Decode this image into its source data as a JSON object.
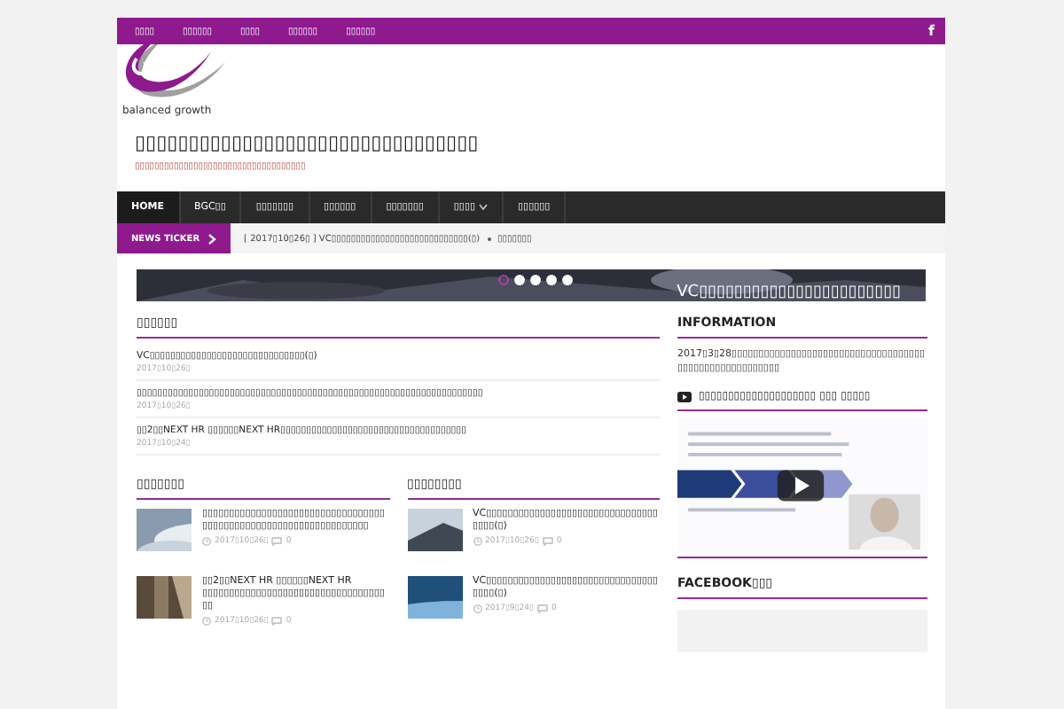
{
  "top_menu": [
    {
      "label": "▯▯▯▯"
    },
    {
      "label": "▯▯▯▯▯▯"
    },
    {
      "label": "▯▯▯▯"
    },
    {
      "label": "▯▯▯▯▯▯"
    },
    {
      "label": "▯▯▯▯▯▯"
    }
  ],
  "social": {
    "label": "f"
  },
  "logo": {
    "text": "balanced growth"
  },
  "site": {
    "title": "▯▯▯▯▯▯▯▯▯▯▯▯▯▯▯▯▯▯▯▯▯▯▯▯▯▯▯▯▯▯▯▯",
    "tagline": "▯▯▯▯▯▯▯▯▯▯▯▯▯▯▯▯▯▯▯▯▯▯▯▯▯▯▯▯▯▯▯▯▯▯▯"
  },
  "main_nav": [
    {
      "label": "HOME",
      "selected": true,
      "dropdown": false
    },
    {
      "label": "BGC▯▯",
      "selected": false,
      "dropdown": false
    },
    {
      "label": "▯▯▯▯▯▯▯",
      "selected": false,
      "dropdown": false
    },
    {
      "label": "▯▯▯▯▯▯",
      "selected": false,
      "dropdown": false
    },
    {
      "label": "▯▯▯▯▯▯▯",
      "selected": false,
      "dropdown": false
    },
    {
      "label": "▯▯▯▯",
      "selected": false,
      "dropdown": true
    },
    {
      "label": "▯▯▯▯▯▯",
      "selected": false,
      "dropdown": false
    }
  ],
  "ticker": {
    "label": "NEWS TICKER",
    "items": [
      "[ 2017▯10▯26▯ ]  VC▯▯▯▯▯▯▯▯▯▯▯▯▯▯▯▯▯▯▯▯▯▯▯▯▯▯▯▯(▯)",
      "▯▯▯▯▯▯▯"
    ]
  },
  "slider": {
    "dots": [
      {
        "selected": true
      },
      {
        "selected": false
      },
      {
        "selected": false
      },
      {
        "selected": false
      },
      {
        "selected": false
      }
    ],
    "caption": "VC▯▯▯▯▯▯▯▯▯▯▯▯▯▯▯▯▯▯▯▯▯▯▯"
  },
  "latest": {
    "heading": "▯▯▯▯▯▯",
    "posts": [
      {
        "title": "VC▯▯▯▯▯▯▯▯▯▯▯▯▯▯▯▯▯▯▯▯▯▯▯▯▯▯▯▯▯▯(▯)",
        "date": "2017▯10▯26▯"
      },
      {
        "title": "▯▯▯▯▯▯▯▯▯▯▯▯▯▯▯▯▯▯▯▯▯▯▯▯▯▯▯▯▯▯▯▯▯▯▯▯▯▯▯▯▯▯▯▯▯▯▯▯▯▯▯▯▯▯▯▯▯▯▯▯▯▯▯▯▯▯▯",
        "date": "2017▯10▯26▯"
      },
      {
        "title": "▯▯2▯▯NEXT HR ▯▯▯▯▯▯NEXT HR▯▯▯▯▯▯▯▯▯▯▯▯▯▯▯▯▯▯▯▯▯▯▯▯▯▯▯▯▯▯▯▯▯▯▯▯",
        "date": "2017▯10▯24▯"
      }
    ]
  },
  "columns": [
    {
      "heading": "▯▯▯▯▯▯▯",
      "posts": [
        {
          "title": "▯▯▯▯▯▯▯▯▯▯▯▯▯▯▯▯▯▯▯▯▯▯▯▯▯▯▯▯▯▯▯▯▯▯▯▯▯▯▯▯▯▯▯▯▯▯▯▯▯▯▯▯▯▯▯▯▯▯▯▯▯▯▯▯▯",
          "date": "2017▯10▯26▯",
          "comments": "0"
        },
        {
          "title": "▯▯2▯▯NEXT HR ▯▯▯▯▯▯NEXT HR ▯▯▯▯▯▯▯▯▯▯▯▯▯▯▯▯▯▯▯▯▯▯▯▯▯▯▯▯▯▯▯▯▯▯▯▯",
          "date": "2017▯10▯26▯",
          "comments": "0"
        }
      ]
    },
    {
      "heading": "▯▯▯▯▯▯▯▯",
      "posts": [
        {
          "title": "VC▯▯▯▯▯▯▯▯▯▯▯▯▯▯▯▯▯▯▯▯▯▯▯▯▯▯▯▯▯▯▯▯▯▯▯▯(▯)",
          "date": "2017▯10▯26▯",
          "comments": "0"
        },
        {
          "title": "VC▯▯▯▯▯▯▯▯▯▯▯▯▯▯▯▯▯▯▯▯▯▯▯▯▯▯▯▯▯▯▯▯▯▯▯▯(▯)",
          "date": "2017▯9▯24▯",
          "comments": "0"
        }
      ]
    }
  ],
  "sidebar": {
    "info_heading": "INFORMATION",
    "info_text": "2017▯3▯28▯▯▯▯▯▯▯▯▯▯▯▯▯▯▯▯▯▯▯▯▯▯▯▯▯▯▯▯▯▯▯▯▯▯▯▯▯▯▯▯▯▯▯▯▯▯▯▯▯▯▯▯▯▯▯",
    "video_heading": "▯▯▯▯▯▯▯▯▯▯▯▯▯▯▯▯▯▯▯▯ ▯▯▯ ▯▯▯▯▯",
    "facebook_heading": "FACEBOOK▯▯▯"
  }
}
